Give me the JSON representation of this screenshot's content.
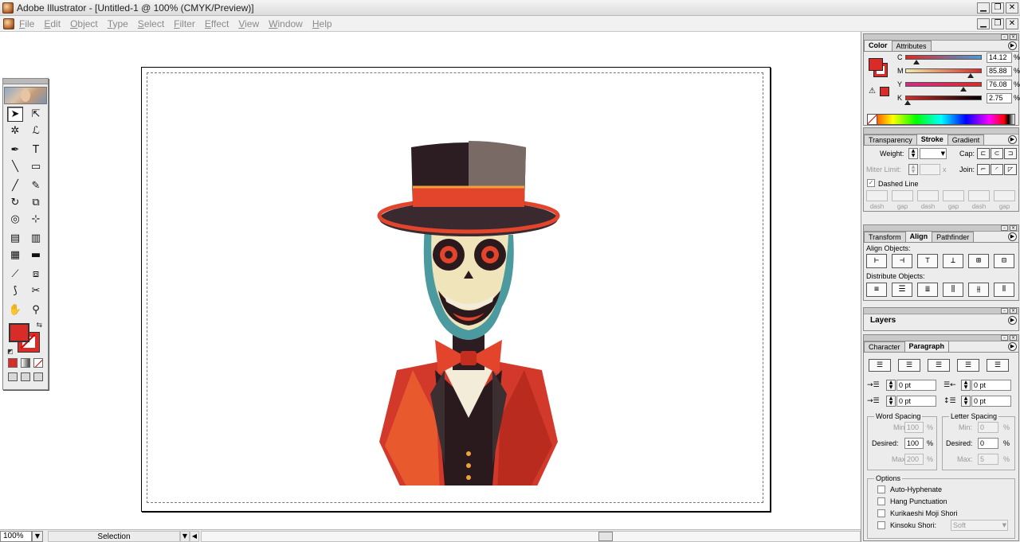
{
  "window": {
    "title": "Adobe Illustrator - [Untitled-1 @ 100% (CMYK/Preview)]",
    "buttons": {
      "minimize": "▁",
      "restore": "❐",
      "close": "✕"
    }
  },
  "menubar": {
    "items": [
      "File",
      "Edit",
      "Object",
      "Type",
      "Select",
      "Filter",
      "Effect",
      "View",
      "Window",
      "Help"
    ]
  },
  "statusbar": {
    "zoom": "100%",
    "status_mode": "Selection"
  },
  "toolbox": {
    "tools": [
      [
        "selection-tool",
        "direct-selection-tool"
      ],
      [
        "magic-wand-tool",
        "lasso-tool"
      ],
      [
        "pen-tool",
        "type-tool"
      ],
      [
        "line-tool",
        "rectangle-tool"
      ],
      [
        "paintbrush-tool",
        "pencil-tool"
      ],
      [
        "rotate-tool",
        "scale-tool"
      ],
      [
        "warp-tool",
        "free-transform-tool"
      ],
      [
        "symbol-sprayer-tool",
        "column-graph-tool"
      ],
      [
        "mesh-tool",
        "gradient-tool"
      ],
      [
        "eyedropper-tool",
        "blend-tool"
      ],
      [
        "slice-tool",
        "scissors-tool"
      ],
      [
        "hand-tool",
        "zoom-tool"
      ]
    ],
    "glyphs": {
      "selection-tool": "➤",
      "direct-selection-tool": "⇱",
      "magic-wand-tool": "✲",
      "lasso-tool": "ℒ",
      "pen-tool": "✒",
      "type-tool": "T",
      "line-tool": "╲",
      "rectangle-tool": "▭",
      "paintbrush-tool": "╱",
      "pencil-tool": "✎",
      "rotate-tool": "↻",
      "scale-tool": "⧉",
      "warp-tool": "◎",
      "free-transform-tool": "⊹",
      "symbol-sprayer-tool": "▤",
      "column-graph-tool": "▥",
      "mesh-tool": "▦",
      "gradient-tool": "▬",
      "eyedropper-tool": "⟋",
      "blend-tool": "⧈",
      "slice-tool": "⟆",
      "scissors-tool": "✂",
      "hand-tool": "✋",
      "zoom-tool": "⚲"
    },
    "fill_color": "#d92b27",
    "stroke_color": "#d92b27"
  },
  "color_panel": {
    "tabs": [
      "Color",
      "Attributes"
    ],
    "channels": [
      {
        "label": "C",
        "value": "14.12",
        "fraction": 0.1412,
        "gradient": "linear-gradient(90deg,#d92b27,#4a9ad4)"
      },
      {
        "label": "M",
        "value": "85.88",
        "fraction": 0.8588,
        "gradient": "linear-gradient(90deg,#f3e9a8,#d92b27)"
      },
      {
        "label": "Y",
        "value": "76.08",
        "fraction": 0.7608,
        "gradient": "linear-gradient(90deg,#d32a8a,#d92b27)"
      },
      {
        "label": "K",
        "value": "2.75",
        "fraction": 0.0275,
        "gradient": "linear-gradient(90deg,#d92b27,#000)"
      }
    ],
    "percent": "%"
  },
  "stroke_panel": {
    "tabs": [
      "Transparency",
      "Stroke",
      "Gradient"
    ],
    "weight_label": "Weight:",
    "weight_value": "",
    "cap_label": "Cap:",
    "miter_label": "Miter Limit:",
    "miter_unit": "x",
    "join_label": "Join:",
    "dashed_label": "Dashed Line",
    "dash_labels": [
      "dash",
      "gap",
      "dash",
      "gap",
      "dash",
      "gap"
    ]
  },
  "align_panel": {
    "tabs": [
      "Transform",
      "Align",
      "Pathfinder"
    ],
    "align_label": "Align Objects:",
    "distribute_label": "Distribute Objects:",
    "align_glyphs": [
      "⊢",
      "⊣",
      "⊤",
      "⊥",
      "⊞",
      "⊟"
    ],
    "distribute_glyphs": [
      "≡",
      "☰",
      "≣",
      "⫼",
      "⫵",
      "⫴"
    ]
  },
  "layers_panel": {
    "title": "Layers"
  },
  "paragraph_panel": {
    "tabs": [
      "Character",
      "Paragraph"
    ],
    "indent_left_value": "0 pt",
    "indent_right_value": "0 pt",
    "first_line_value": "0 pt",
    "space_before_value": "0 pt",
    "word_spacing": {
      "title": "Word Spacing",
      "min_label": "Min:",
      "min": "100",
      "desired_label": "Desired:",
      "desired": "100",
      "max_label": "Max:",
      "max": "200"
    },
    "letter_spacing": {
      "title": "Letter Spacing",
      "min_label": "Min:",
      "min": "0",
      "desired_label": "Desired:",
      "desired": "0",
      "max_label": "Max:",
      "max": "5"
    },
    "options_title": "Options",
    "options": [
      "Auto-Hyphenate",
      "Hang Punctuation",
      "Kurikaeshi Moji Shori",
      "Kinsoku Shori:"
    ],
    "kinsoku_value": "Soft",
    "percent": "%"
  }
}
